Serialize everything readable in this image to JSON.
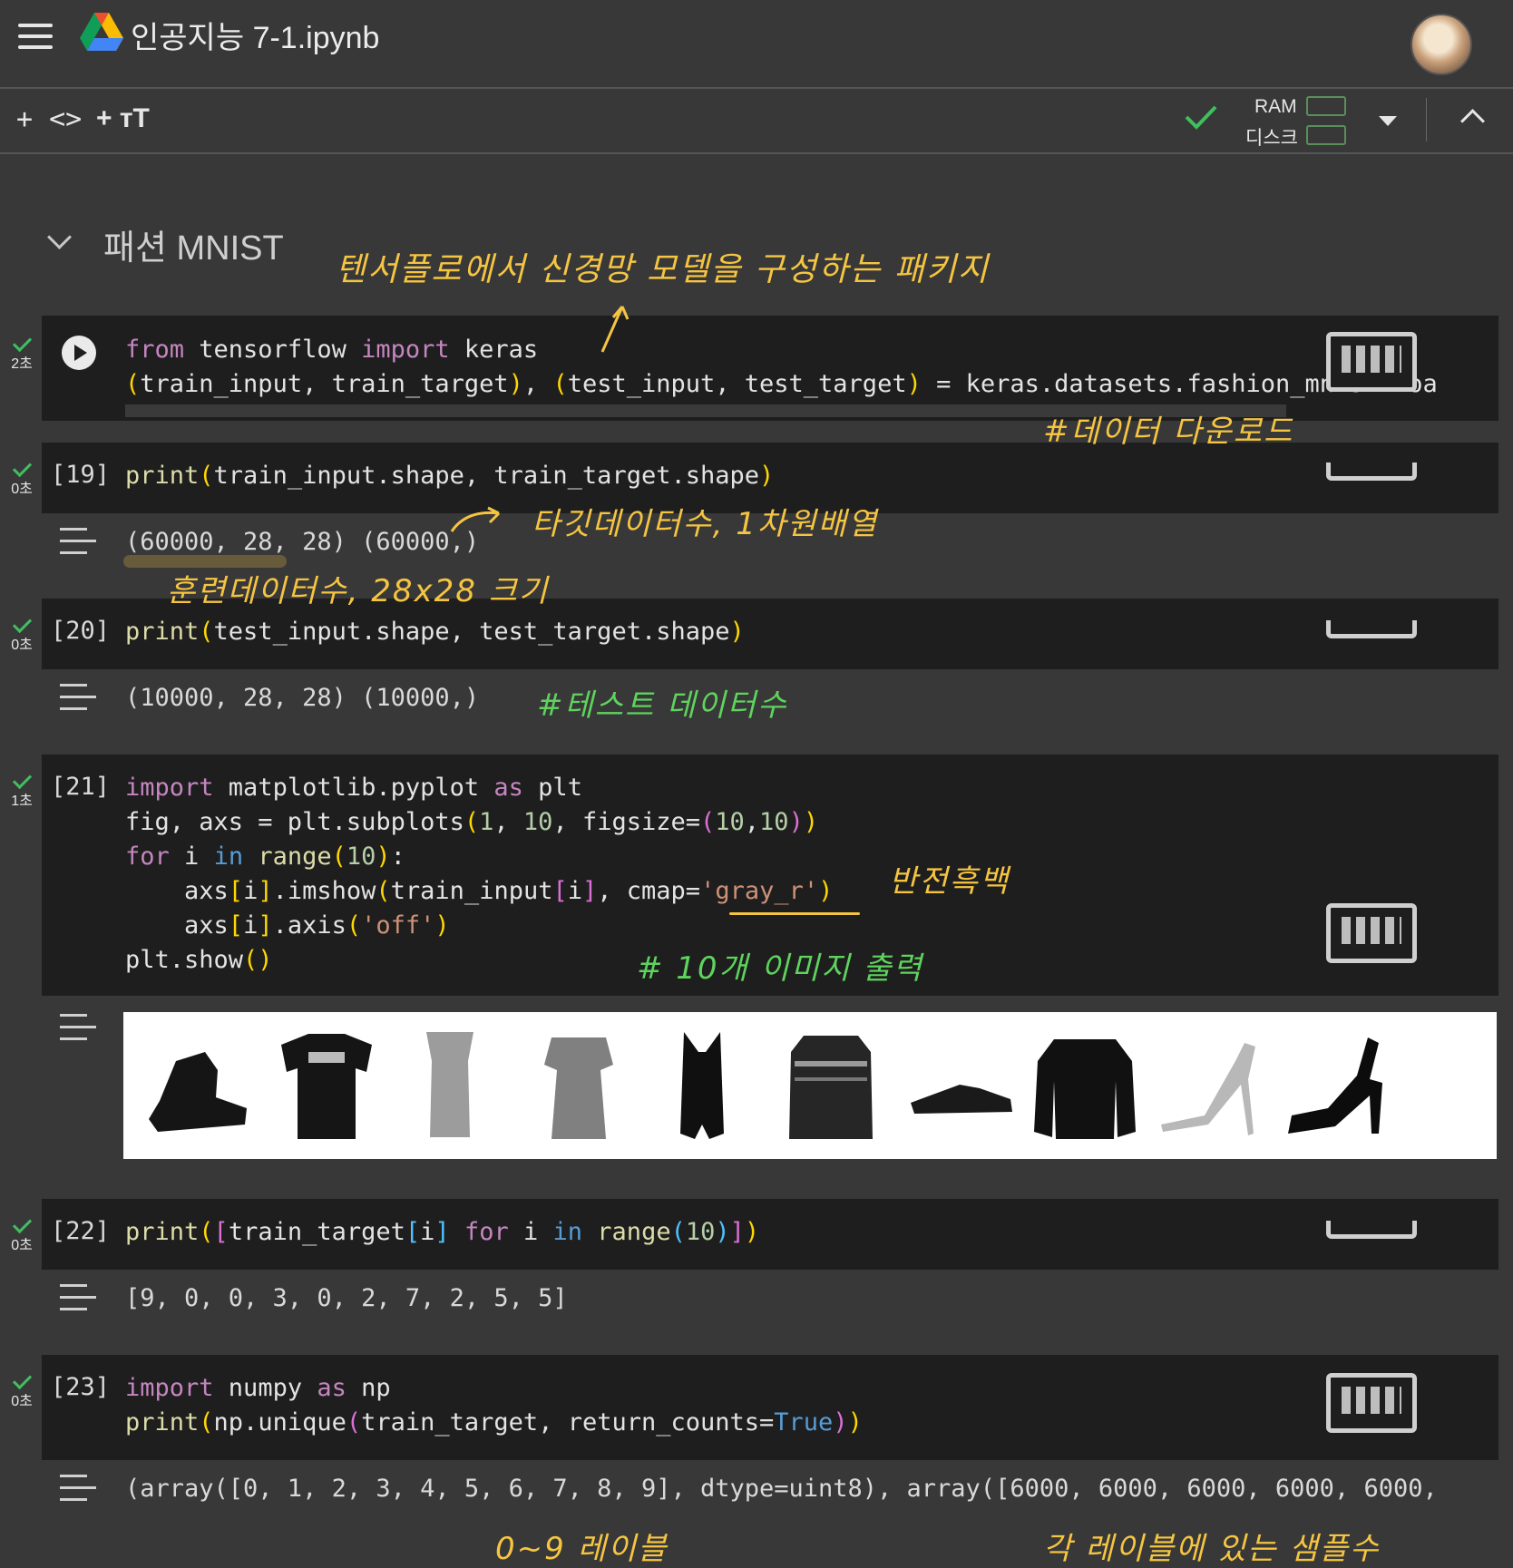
{
  "header": {
    "title": "인공지능 7-1.ipynb"
  },
  "toolbar": {
    "add_code": "+ <>",
    "add_text": "+ ᴛT",
    "ram_label": "RAM",
    "disk_label": "디스크"
  },
  "section": {
    "title": "패션 MNIST"
  },
  "cells": [
    {
      "status_time": "2초",
      "exec_count": "",
      "code_lines": [
        "from tensorflow import keras",
        "(train_input, train_target), (test_input, test_target) = keras.datasets.fashion_mnist.loa"
      ]
    },
    {
      "status_time": "0초",
      "exec_count": "[19]",
      "code_lines": [
        "print(train_input.shape, train_target.shape)"
      ],
      "output": "(60000, 28, 28) (60000,)"
    },
    {
      "status_time": "0초",
      "exec_count": "[20]",
      "code_lines": [
        "print(test_input.shape, test_target.shape)"
      ],
      "output": "(10000, 28, 28) (10000,)"
    },
    {
      "status_time": "1초",
      "exec_count": "[21]",
      "code_lines": [
        "import matplotlib.pyplot as plt",
        "fig, axs = plt.subplots(1, 10, figsize=(10,10))",
        "for i in range(10):",
        "    axs[i].imshow(train_input[i], cmap='gray_r')",
        "    axs[i].axis('off')",
        "plt.show()"
      ]
    },
    {
      "status_time": "0초",
      "exec_count": "[22]",
      "code_lines": [
        "print([train_target[i] for i in range(10)])"
      ],
      "output": "[9, 0, 0, 3, 0, 2, 7, 2, 5, 5]"
    },
    {
      "status_time": "0초",
      "exec_count": "[23]",
      "code_lines": [
        "import numpy as np",
        "print(np.unique(train_target, return_counts=True))"
      ],
      "output": "(array([0, 1, 2, 3, 4, 5, 6, 7, 8, 9], dtype=uint8), array([6000, 6000, 6000, 6000, 6000,"
    }
  ],
  "annotations": {
    "keras_note": "텐서플로에서 신경망 모델을 구성하는 패키지",
    "download_note": "#데이터 다운로드",
    "target_note": "타깃데이터수, 1차원배열",
    "train_note": "훈련데이터수, 28x28 크기",
    "test_note": "#테스트 데이터수",
    "invert_note": "반전흑백",
    "images_note": "# 10개 이미지 출력",
    "label_note": "0~9 레이블",
    "count_note": "각 레이블에 있는 샘플수"
  },
  "icons": {
    "menu": "hamburger-menu-icon",
    "drive": "google-drive-icon",
    "status": "check-icon",
    "keyboard": "keyboard-icon",
    "output": "output-toggle-icon"
  },
  "colors": {
    "background": "#383838",
    "code_bg": "#1e1e1e",
    "note_yellow": "#f5c542",
    "note_green": "#5ed35e",
    "status_green": "#3fbf5f"
  }
}
